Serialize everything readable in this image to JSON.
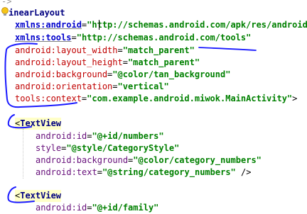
{
  "editor": {
    "fold_marker": "->",
    "lines": {
      "l1": {
        "name": "inearLayout"
      },
      "l2": {
        "attr": "xmlns:android",
        "eq": "=",
        "value": "\"http://schemas.android.com/apk/res/android\""
      },
      "l3": {
        "attr": "xmlns:tools",
        "eq": "=",
        "value": "\"http://schemas.android.com/tools\""
      },
      "l4": {
        "attr": "android:layout_width",
        "eq": "=",
        "value": "\"match_parent\""
      },
      "l5": {
        "attr": "android:layout_height",
        "eq": "=",
        "value": "\"match_parent\""
      },
      "l6": {
        "attr": "android:background",
        "eq": "=",
        "value": "\"@color/tan_background\""
      },
      "l7": {
        "attr": "android:orientation",
        "eq": "=",
        "value": "\"vertical\""
      },
      "l8": {
        "attr": "tools:context",
        "eq": "=",
        "value": "\"com.example.android.miwok.MainActivity\"",
        "close": ">"
      },
      "l9": {
        "open": "<",
        "name": "TextView"
      },
      "l10": {
        "attr": "android:id",
        "eq": "=",
        "value": "\"@+id/numbers\""
      },
      "l11": {
        "attr": "style",
        "eq": "=",
        "value": "\"@style/CategoryStyle\""
      },
      "l12": {
        "attr": "android:background",
        "eq": "=",
        "value": "\"@color/category_numbers\""
      },
      "l13": {
        "attr": "android:text",
        "eq": "=",
        "value": "\"@string/category_numbers\"",
        "close": " />"
      },
      "l14": {
        "open": "<",
        "name": "TextView"
      },
      "l15": {
        "attr": "android:id",
        "eq": "=",
        "value": "\"@+id/family\""
      }
    }
  },
  "colors": {
    "tag": "#000080",
    "attribute": "#660e7a",
    "string": "#008000",
    "annotation_ink": "#1a1aff"
  }
}
